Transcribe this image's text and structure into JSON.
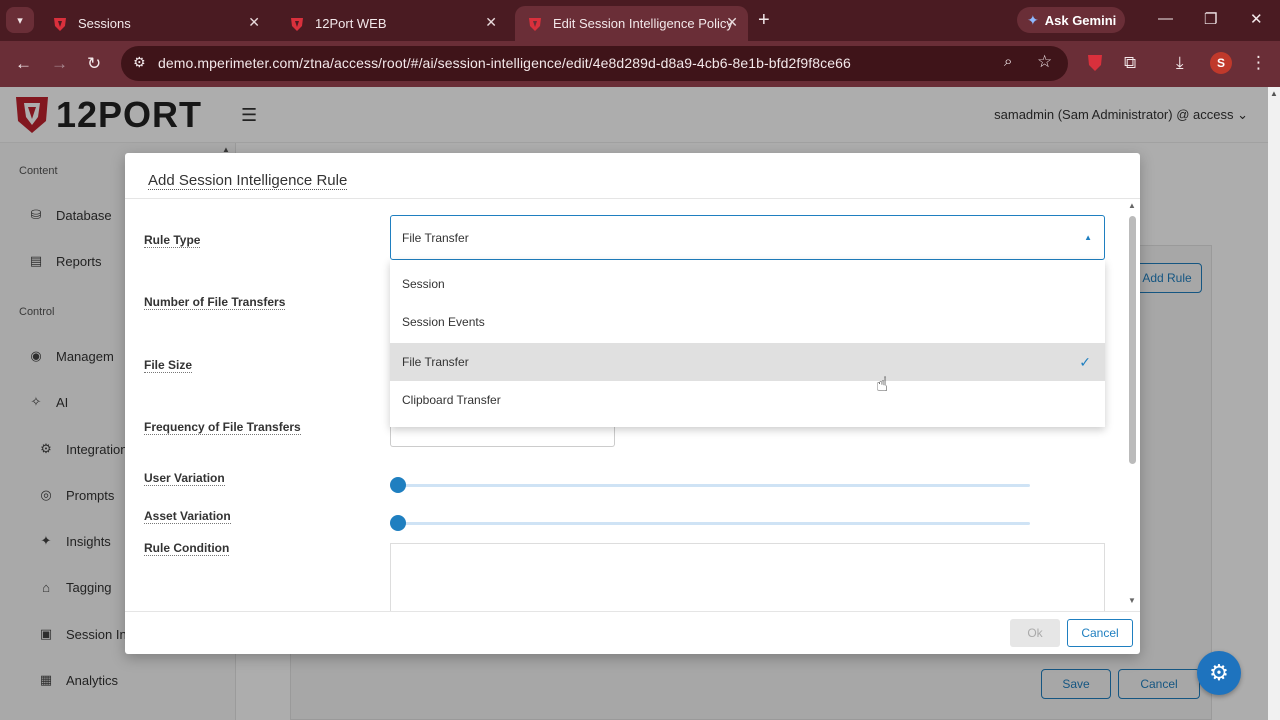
{
  "browser": {
    "tabs": [
      {
        "title": "Sessions",
        "active": false
      },
      {
        "title": "12Port WEB",
        "active": false
      },
      {
        "title": "Edit Session Intelligence Policy",
        "active": true
      }
    ],
    "gemini_label": "Ask Gemini",
    "url": "demo.mperimeter.com/ztna/access/root/#/ai/session-intelligence/edit/4e8d289d-d8a9-4cb6-8e1b-bfd2f9f8ce66",
    "profile_initial": "S"
  },
  "app": {
    "logo_text": "12PORT",
    "user_menu": "samadmin (Sam Administrator) @ access",
    "sidebar": {
      "sections": [
        {
          "label": "Content"
        },
        {
          "label": "Control"
        }
      ],
      "items": [
        {
          "label": "Database",
          "icon": "database-icon"
        },
        {
          "label": "Reports",
          "icon": "reports-icon"
        },
        {
          "label": "Managem",
          "icon": "management-icon"
        },
        {
          "label": "AI",
          "icon": "ai-sparkle-icon"
        },
        {
          "label": "Integration",
          "icon": "integration-gear-icon"
        },
        {
          "label": "Prompts",
          "icon": "prompts-icon"
        },
        {
          "label": "Insights",
          "icon": "insights-icon"
        },
        {
          "label": "Tagging",
          "icon": "tag-icon"
        },
        {
          "label": "Session Int",
          "icon": "session-icon"
        },
        {
          "label": "Analytics",
          "icon": "analytics-icon"
        }
      ]
    },
    "background_buttons": {
      "add_rule": "Add Rule",
      "save": "Save",
      "cancel": "Cancel"
    }
  },
  "modal": {
    "title": "Add Session Intelligence Rule",
    "fields": {
      "rule_type": "Rule Type",
      "number_of_file_transfers": "Number of File Transfers",
      "file_size": "File Size",
      "frequency_of_file_transfers": "Frequency of File Transfers",
      "user_variation": "User Variation",
      "asset_variation": "Asset Variation",
      "rule_condition": "Rule Condition"
    },
    "rule_type_value": "File Transfer",
    "rule_type_options": [
      "Session",
      "Session Events",
      "File Transfer",
      "Clipboard Transfer"
    ],
    "selected_option_index": 2,
    "user_variation_value": 0,
    "asset_variation_value": 0,
    "ok_label": "Ok",
    "cancel_label": "Cancel"
  },
  "colors": {
    "browser_frame": "#4a1b22",
    "accent": "#1f7fc0",
    "logo_red": "#c0232f"
  }
}
